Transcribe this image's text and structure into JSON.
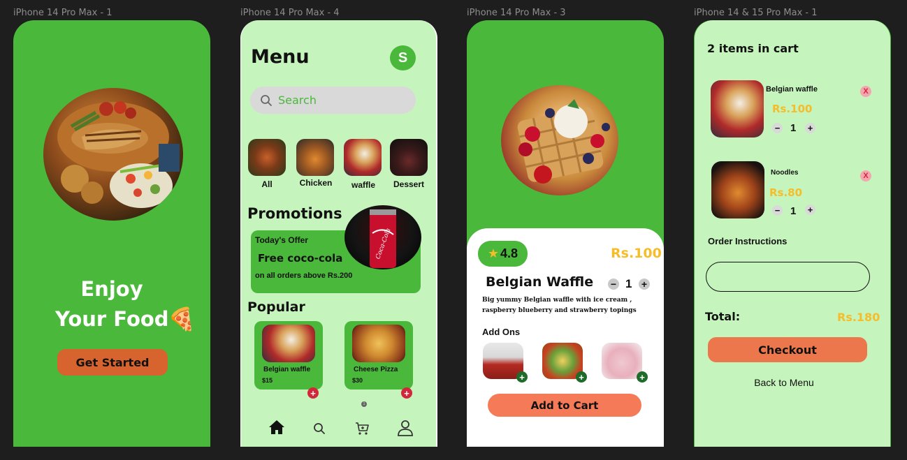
{
  "frames": [
    {
      "label": "iPhone 14 Pro Max - 1"
    },
    {
      "label": "iPhone 14 Pro Max - 4"
    },
    {
      "label": "iPhone 14 Pro Max - 3"
    },
    {
      "label": "iPhone 14 & 15 Pro Max - 1"
    }
  ],
  "splash": {
    "line1": "Enjoy",
    "line2": "Your Food",
    "emoji": "🍕",
    "button": "Get Started"
  },
  "menu": {
    "title": "Menu",
    "avatar": "S",
    "search_placeholder": "Search",
    "categories": [
      {
        "label": "All"
      },
      {
        "label": "Chicken"
      },
      {
        "label": "waffle"
      },
      {
        "label": "Dessert"
      }
    ],
    "promotions_title": "Promotions",
    "promo": {
      "kicker": "Today's Offer",
      "headline": "Free coco-cola",
      "subtext": "on all orders above Rs.200",
      "can_text": "Coca-Cola"
    },
    "popular_title": "Popular",
    "popular": [
      {
        "name": "Belgian waffle",
        "price": "$15"
      },
      {
        "name": "Cheese Pizza",
        "price": "$30"
      }
    ],
    "pager_dot": "1",
    "nav": [
      "home-icon",
      "search-icon",
      "cart-icon",
      "user-icon"
    ]
  },
  "detail": {
    "rating": "4.8",
    "price": "Rs.100",
    "name": "Belgian Waffle",
    "qty": "1",
    "description": "Big yummy Belgian waffle with ice cream , raspberry blueberry and strawberry topings",
    "addons_title": "Add Ons",
    "button": "Add to Cart"
  },
  "cart": {
    "title": "2 items in cart",
    "items": [
      {
        "name": "Belgian waffle",
        "price": "Rs.100",
        "qty": "1"
      },
      {
        "name": "Noodles",
        "price": "Rs.80",
        "qty": "1"
      }
    ],
    "remove": "X",
    "instructions_label": "Order Instructions",
    "total_label": "Total:",
    "total_value": "Rs.180",
    "checkout": "Checkout",
    "back": "Back to Menu"
  },
  "colors": {
    "green": "#4ab83a",
    "light_green": "#c6f4bd",
    "orange": "#d7642e",
    "coral": "#f57a57",
    "yellow": "#f5bd2a",
    "red": "#d2263a",
    "dark_bg": "#1e1e1e"
  }
}
